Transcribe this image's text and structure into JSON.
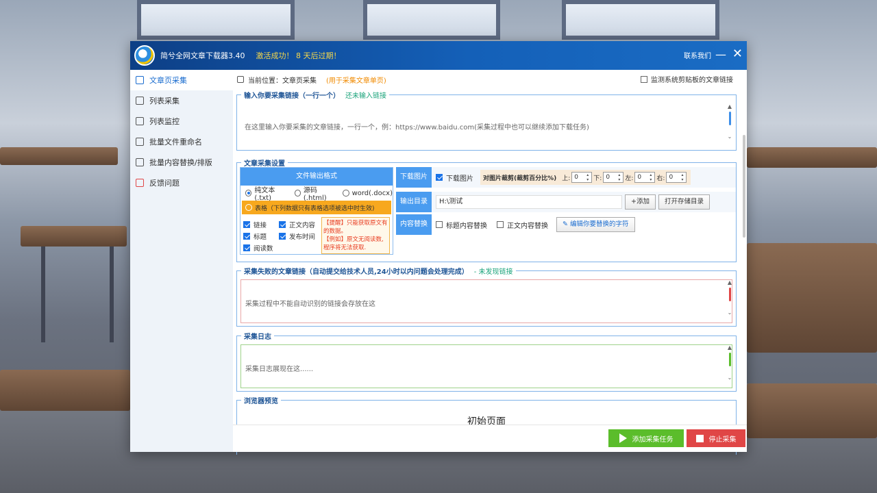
{
  "window": {
    "app_title": "简兮全网文章下载器3.40",
    "activation": "激活成功！ 8 天后过期！",
    "contact": "联系我们",
    "minimize": "—",
    "close": "✕"
  },
  "sidebar": {
    "items": [
      {
        "label": "文章页采集",
        "icon": "document-icon",
        "active": true
      },
      {
        "label": "列表采集",
        "icon": "list-search-icon"
      },
      {
        "label": "列表监控",
        "icon": "monitor-icon"
      },
      {
        "label": "批量文件重命名",
        "icon": "headset-icon"
      },
      {
        "label": "批量内容替换/排版",
        "icon": "replace-icon"
      },
      {
        "label": "反馈问题",
        "icon": "feedback-icon"
      }
    ]
  },
  "breadcrumb": {
    "prefix": "当前位置：",
    "page": "文章页采集",
    "note": "(用于采集文章单页)"
  },
  "clipboard_monitor": {
    "label": "监测系统剪贴板的文章链接",
    "checked": false
  },
  "link_group": {
    "title": "输入你要采集链接（一行一个）",
    "status": "还未输入链接",
    "placeholder": "在这里输入你要采集的文章链接，一行一个，例：https://www.baidu.com(采集过程中也可以继续添加下载任务)"
  },
  "settings_group": {
    "title": "文章采集设置",
    "format": {
      "header": "文件输出格式",
      "options": [
        {
          "label": "纯文本(.txt)",
          "selected": true
        },
        {
          "label": "源码(.html)",
          "selected": false
        },
        {
          "label": "word(.docx)",
          "selected": false
        }
      ],
      "table_option": "表格（下列数据只有表格选项被选中时生效)",
      "fields": [
        {
          "label": "链接",
          "checked": true
        },
        {
          "label": "正文内容",
          "checked": true
        },
        {
          "label": "标题",
          "checked": true
        },
        {
          "label": "发布时间",
          "checked": true
        },
        {
          "label": "阅读数",
          "checked": true
        }
      ],
      "tip_line1": "【提醒】只能获取原文有的数据。",
      "tip_line2": "【例如】原文无阅读数,程序将无法获取."
    },
    "download_images": {
      "label": "下载图片",
      "checkbox": "下载图片",
      "checked": true,
      "crop_label": "对图片裁剪(裁剪百分比%)",
      "top_label": "上:",
      "top_value": "0",
      "bottom_label": "下:",
      "bottom_value": "0",
      "left_label": "左:",
      "left_value": "0",
      "right_label": "右:",
      "right_value": "0"
    },
    "output_dir": {
      "label": "输出目录",
      "path": "H:\\测试",
      "add_button": "+添加",
      "open_button": "打开存储目录"
    },
    "content_replace": {
      "label": "内容替换",
      "title_replace": "标题内容替换",
      "body_replace": "正文内容替换",
      "edit_button": "编辑你要替换的字符"
    }
  },
  "failed_group": {
    "title": "采集失败的文章链接（自动提交给技术人员,24小时以内问题会处理完成）",
    "status": "- 未发现链接",
    "placeholder": "采集过程中不能自动识别的链接会存放在这"
  },
  "log_group": {
    "title": "采集日志",
    "placeholder": "采集日志展现在这......"
  },
  "preview_group": {
    "title": "浏览器预览",
    "page_title": "初始页面"
  },
  "actions": {
    "add_task": "添加采集任务",
    "stop": "停止采集"
  },
  "colors": {
    "titlebar": "#1460b8",
    "accent": "#4a9cf0",
    "add_button": "#5bbd2b",
    "stop_button": "#e04646",
    "warning": "#f7a81e"
  }
}
